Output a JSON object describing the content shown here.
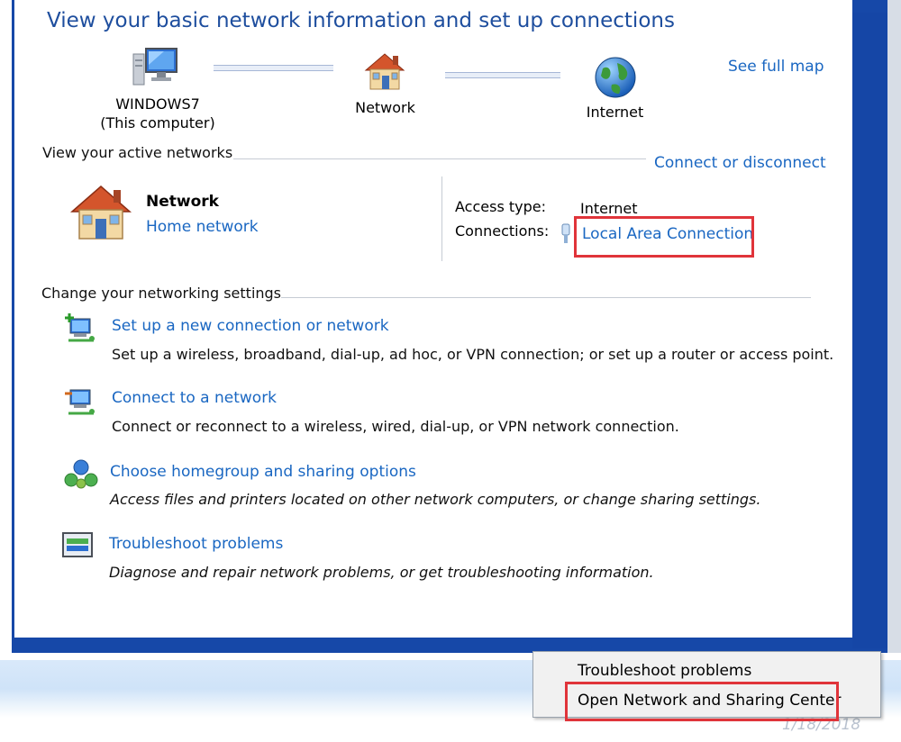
{
  "header": {
    "title": "View your basic network information and set up connections",
    "see_full_map": "See full map"
  },
  "map": {
    "computer_name": "WINDOWS7",
    "computer_sub": "(This computer)",
    "network_label": "Network",
    "internet_label": "Internet"
  },
  "active_networks": {
    "heading": "View your active networks",
    "connect_disconnect": "Connect or disconnect",
    "network_name": "Network",
    "network_type": "Home network",
    "access_type_label": "Access type:",
    "access_type_value": "Internet",
    "connections_label": "Connections:",
    "connection_link": "Local Area Connection"
  },
  "settings": {
    "heading": "Change your networking settings",
    "tasks": [
      {
        "icon": "new-connection-icon",
        "label": "Set up a new connection or network",
        "description": "Set up a wireless, broadband, dial-up, ad hoc, or VPN connection; or set up a router or access point."
      },
      {
        "icon": "connect-network-icon",
        "label": "Connect to a network",
        "description": "Connect or reconnect to a wireless, wired, dial-up, or VPN network connection."
      },
      {
        "icon": "homegroup-icon",
        "label": "Choose homegroup and sharing options",
        "description": "Access files and printers located on other network computers, or change sharing settings."
      },
      {
        "icon": "troubleshoot-icon",
        "label": "Troubleshoot problems",
        "description": "Diagnose and repair network problems, or get troubleshooting information."
      }
    ]
  },
  "context_menu": {
    "items": [
      "Troubleshoot problems",
      "Open Network and Sharing Center"
    ]
  },
  "taskbar": {
    "clock": "1/18/2018"
  },
  "colors": {
    "link": "#1a67c2",
    "title": "#1e4e9e",
    "frame": "#1648a8",
    "highlight": "#e0343a"
  }
}
